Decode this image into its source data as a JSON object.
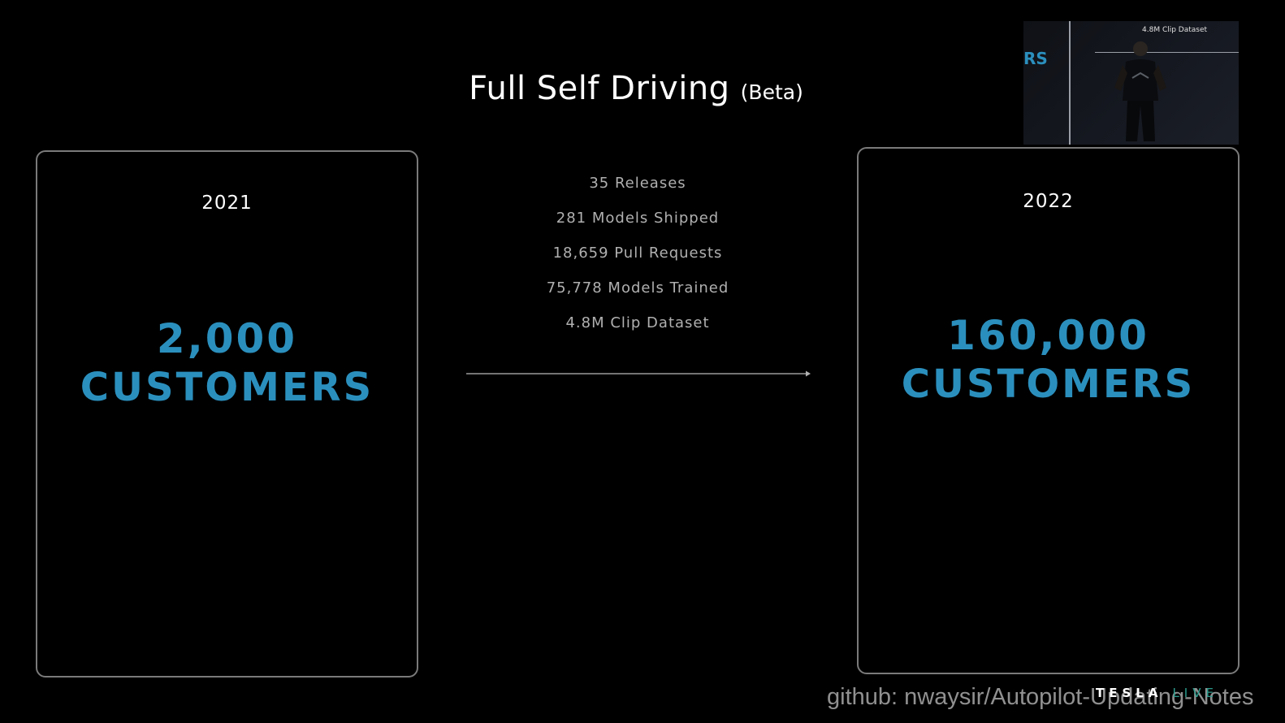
{
  "slide": {
    "title": "Full Self Driving",
    "title_suffix": "(Beta)",
    "left_card": {
      "year": "2021",
      "number": "2,000",
      "label": "CUSTOMERS"
    },
    "right_card": {
      "year": "2022",
      "number": "160,000",
      "label": "CUSTOMERS"
    },
    "stats": [
      "35 Releases",
      "281 Models Shipped",
      "18,659 Pull Requests",
      "75,778 Models Trained",
      "4.8M Clip Dataset"
    ],
    "accent_color": "#2b8fbd"
  },
  "speaker_inset": {
    "caption": "4.8M Clip Dataset",
    "fragment": "RS"
  },
  "branding": {
    "logo_word": "TESLA",
    "live_word": "LIVE",
    "live_color": "#2a9a8c"
  },
  "watermark": "github: nwaysir/Autopilot-Updating-Notes"
}
